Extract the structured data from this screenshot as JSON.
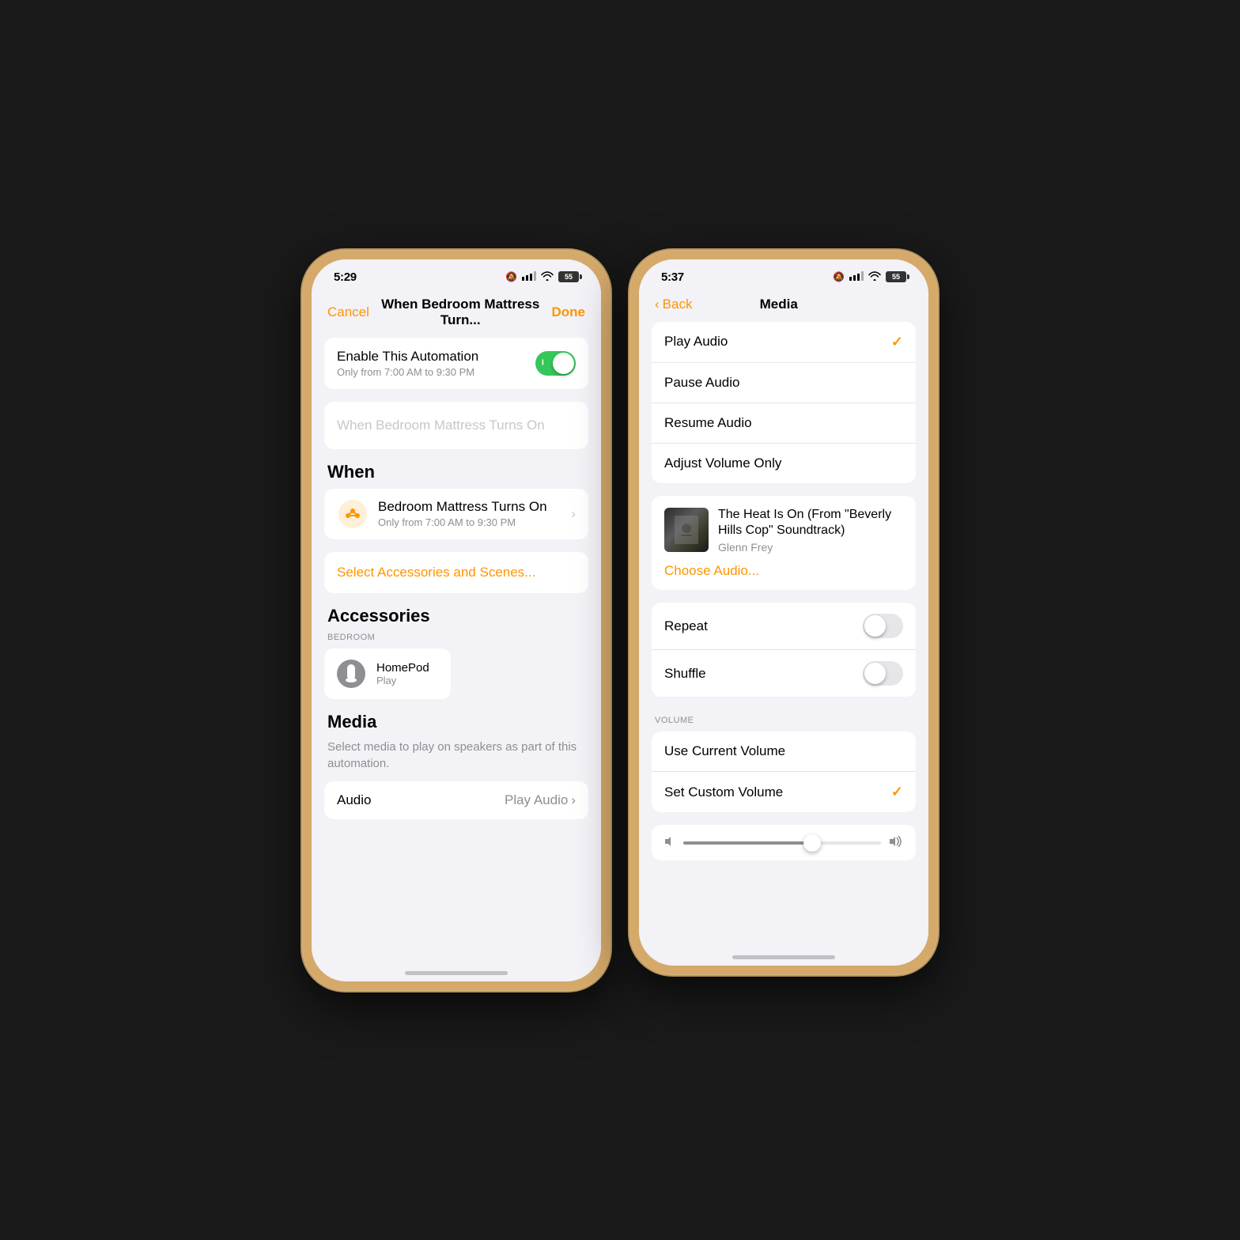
{
  "left_phone": {
    "status": {
      "time": "5:29",
      "mute": true,
      "signal": "●●●●",
      "wifi": "wifi",
      "battery": "55"
    },
    "nav": {
      "cancel": "Cancel",
      "title": "When Bedroom Mattress Turn...",
      "done": "Done"
    },
    "enable": {
      "label": "Enable This Automation",
      "sublabel": "Only from 7:00 AM to 9:30 PM",
      "enabled": true
    },
    "placeholder": "When Bedroom Mattress Turns On",
    "when_header": "When",
    "trigger": {
      "title": "Bedroom Mattress Turns On",
      "subtitle": "Only from 7:00 AM to 9:30 PM"
    },
    "select_accessories": "Select Accessories and Scenes...",
    "accessories_header": "Accessories",
    "bedroom_label": "BEDROOM",
    "homepod": {
      "name": "HomePod",
      "action": "Play"
    },
    "media_header": "Media",
    "media_desc": "Select media to play on speakers as part of this automation.",
    "audio": {
      "label": "Audio",
      "value": "Play Audio"
    }
  },
  "right_phone": {
    "status": {
      "time": "5:37",
      "mute": true,
      "signal": "●●●●",
      "wifi": "wifi",
      "battery": "55"
    },
    "nav": {
      "back": "Back",
      "title": "Media"
    },
    "options": [
      {
        "label": "Play Audio",
        "checked": true
      },
      {
        "label": "Pause Audio",
        "checked": false
      },
      {
        "label": "Resume Audio",
        "checked": false
      },
      {
        "label": "Adjust Volume Only",
        "checked": false
      }
    ],
    "song": {
      "title": "The Heat Is On (From \"Beverly Hills Cop\" Soundtrack)",
      "artist": "Glenn Frey"
    },
    "choose_audio": "Choose Audio...",
    "repeat_label": "Repeat",
    "shuffle_label": "Shuffle",
    "volume_header": "VOLUME",
    "volume_options": [
      {
        "label": "Use Current Volume",
        "checked": false
      },
      {
        "label": "Set Custom Volume",
        "checked": true
      }
    ],
    "slider_value": 65
  }
}
